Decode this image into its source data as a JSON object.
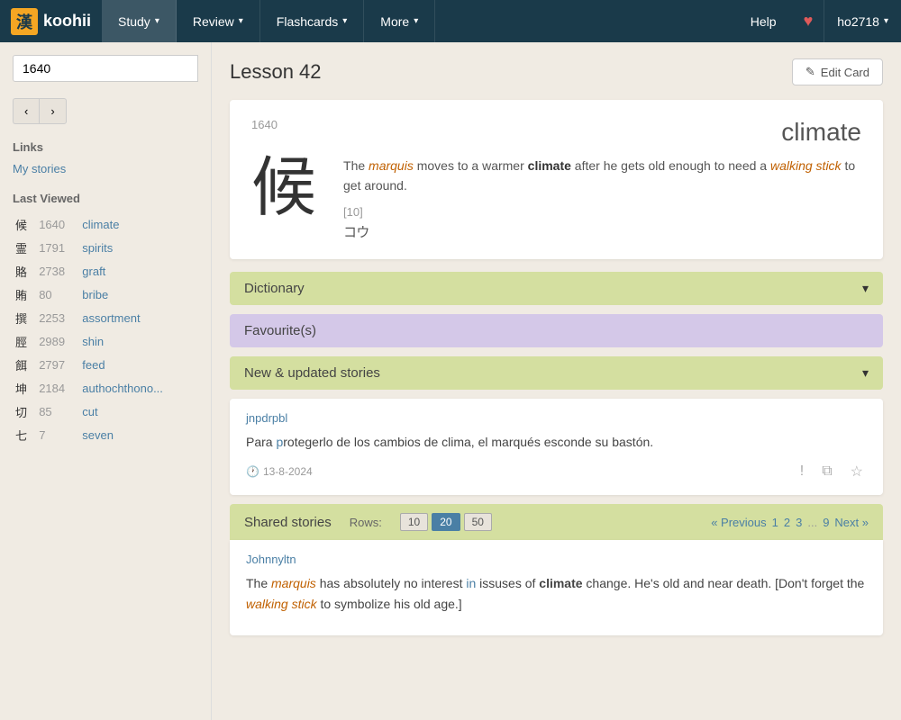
{
  "navbar": {
    "logo_kanji": "漢",
    "logo_text": "koohii",
    "items": [
      {
        "label": "Study",
        "id": "study",
        "active": true
      },
      {
        "label": "Review",
        "id": "review"
      },
      {
        "label": "Flashcards",
        "id": "flashcards"
      },
      {
        "label": "More",
        "id": "more"
      }
    ],
    "help": "Help",
    "heart": "♥",
    "user": "ho2718"
  },
  "sidebar": {
    "search_value": "1640",
    "prev_btn": "‹",
    "next_btn": "›",
    "links_title": "Links",
    "my_stories": "My stories",
    "last_viewed_title": "Last Viewed",
    "last_viewed": [
      {
        "kanji": "候",
        "num": "1640",
        "keyword": "climate"
      },
      {
        "kanji": "霊",
        "num": "1791",
        "keyword": "spirits"
      },
      {
        "kanji": "賂",
        "num": "2738",
        "keyword": "graft"
      },
      {
        "kanji": "賄",
        "num": "80",
        "keyword": "bribe"
      },
      {
        "kanji": "撰",
        "num": "2253",
        "keyword": "assortment"
      },
      {
        "kanji": "脛",
        "num": "2989",
        "keyword": "shin"
      },
      {
        "kanji": "餌",
        "num": "2797",
        "keyword": "feed"
      },
      {
        "kanji": "坤",
        "num": "2184",
        "keyword": "authochthono..."
      },
      {
        "kanji": "切",
        "num": "85",
        "keyword": "cut"
      },
      {
        "kanji": "七",
        "num": "7",
        "keyword": "seven"
      }
    ]
  },
  "lesson": {
    "title": "Lesson 42",
    "edit_btn": "Edit Card",
    "card": {
      "number": "1640",
      "keyword": "climate",
      "kanji": "候",
      "story": "The <em>marquis</em> moves to a warmer <strong>climate</strong> after he gets old enough to need a <em>walking stick</em> to get around.",
      "stroke": "[10]",
      "reading": "コウ"
    }
  },
  "dictionary": {
    "title": "Dictionary",
    "collapsed": true
  },
  "favourites": {
    "title": "Favourite(s)"
  },
  "new_stories": {
    "title": "New & updated stories",
    "collapsed": false,
    "story": {
      "author": "jnpdrpbl",
      "text": "Para <span class='highlight-blue'>p</span>rotegerlo de los cambios de clima, el marqués esconde su bastón.",
      "date": "13-8-2024",
      "clock_icon": "🕐"
    }
  },
  "shared_stories": {
    "title": "Shared stories",
    "rows_label": "Rows:",
    "rows_options": [
      "10",
      "20",
      "50"
    ],
    "active_rows": "20",
    "pagination": {
      "prev": "« Previous",
      "pages": [
        "1",
        "2",
        "3"
      ],
      "ellipsis": "...",
      "last": "9",
      "next": "Next »"
    },
    "story": {
      "author": "Johnnyltn",
      "text": "The <em>marquis</em> has absolutely no interest <span class='highlight-blue'>in</span> issuses of <strong>climate</strong> change. He's old and near death. [Don't forget the <em>walking stick</em> to symbolize his old age.]"
    }
  }
}
